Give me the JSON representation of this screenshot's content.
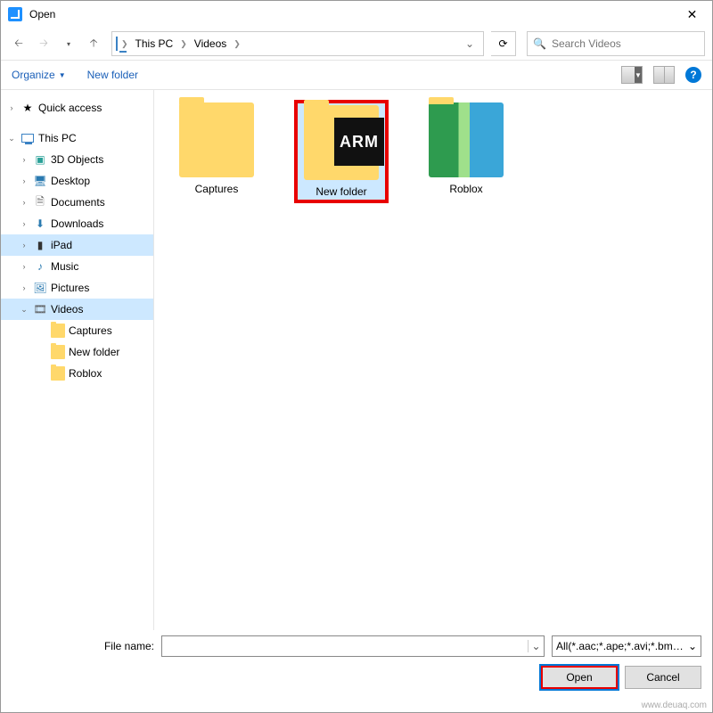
{
  "window": {
    "title": "Open"
  },
  "breadcrumb": {
    "root_icon": "pc-icon",
    "items": [
      "This PC",
      "Videos"
    ]
  },
  "search": {
    "placeholder": "Search Videos"
  },
  "toolbar": {
    "organize": "Organize",
    "new_folder": "New folder"
  },
  "tree": {
    "quick_access": "Quick access",
    "this_pc": "This PC",
    "pc_children": [
      "3D Objects",
      "Desktop",
      "Documents",
      "Downloads",
      "iPad",
      "Music",
      "Pictures",
      "Videos"
    ],
    "videos_children": [
      "Captures",
      "New folder",
      "Roblox"
    ],
    "selected_pc_child": "iPad",
    "selected_pc_child2": "Videos"
  },
  "content": {
    "items": [
      {
        "label": "Captures",
        "kind": "folder"
      },
      {
        "label": "New folder",
        "kind": "folder-preview",
        "selected": true
      },
      {
        "label": "Roblox",
        "kind": "roblox"
      }
    ]
  },
  "footer": {
    "file_name_label": "File name:",
    "file_name_value": "",
    "filter": "All(*.aac;*.ape;*.avi;*.bmp;*.csv",
    "open": "Open",
    "cancel": "Cancel"
  },
  "watermark": "www.deuaq.com"
}
